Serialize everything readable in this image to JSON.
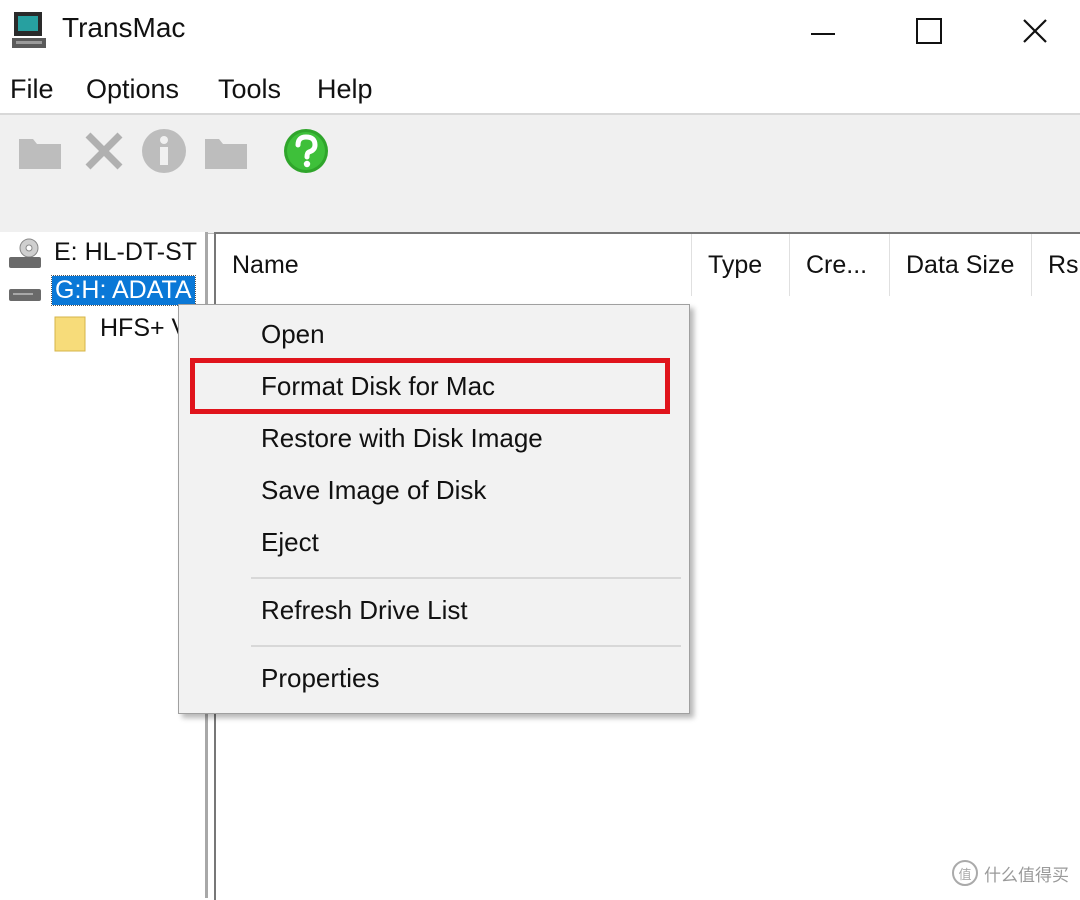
{
  "window": {
    "title": "TransMac",
    "minimize_icon": "minimize-icon",
    "maximize_icon": "maximize-icon",
    "close_icon": "close-icon"
  },
  "menu": {
    "items": [
      {
        "label": "File"
      },
      {
        "label": "Options"
      },
      {
        "label": "Tools"
      },
      {
        "label": "Help"
      }
    ]
  },
  "toolbar": {
    "icons": [
      "open-folder-icon",
      "delete-icon",
      "info-icon",
      "new-folder-icon",
      "help-icon"
    ],
    "help_color": "#2fa52b"
  },
  "tree": {
    "items": [
      {
        "label": "E: HL-DT-ST",
        "icon": "optical-drive-icon"
      },
      {
        "label": "G:H: ADATA",
        "icon": "hard-drive-icon",
        "selected": true
      },
      {
        "label": "HFS+ V",
        "icon": "folder-icon"
      }
    ]
  },
  "list": {
    "columns": [
      {
        "label": "Name"
      },
      {
        "label": "Type"
      },
      {
        "label": "Cre..."
      },
      {
        "label": "Data Size"
      },
      {
        "label": "Rsr"
      }
    ]
  },
  "context_menu": {
    "items": [
      {
        "label": "Open"
      },
      {
        "label": "Format Disk for Mac",
        "highlighted": true
      },
      {
        "label": "Restore with Disk Image"
      },
      {
        "label": "Save Image of Disk"
      },
      {
        "label": "Eject"
      },
      {
        "label": "Refresh Drive List"
      },
      {
        "label": "Properties"
      }
    ],
    "highlight_color": "#e0141c"
  },
  "watermark": {
    "symbol": "值",
    "text": "什么值得买"
  }
}
